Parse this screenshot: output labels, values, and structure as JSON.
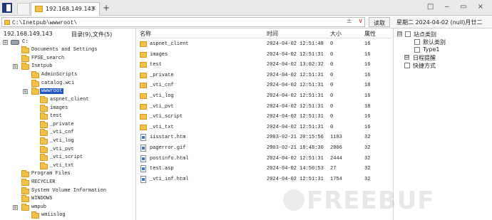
{
  "tabbar": {
    "active_tab": "192.168.149.143",
    "close_glyph": "×",
    "add_glyph": "+",
    "window_buttons": "□ ‒ ▭ ×"
  },
  "address": {
    "path": "C:\\Inetpub\\wwwroot\\",
    "read_label": "读取",
    "date_text": "星期二  2024-04-02 (null)月廿二",
    "ctrl_add": "±",
    "ctrl_chevron": "∨"
  },
  "left": {
    "host": "192.168.149.143",
    "counts": "目录(9),文件(5)",
    "tree": [
      {
        "label": "C:",
        "exp": "⊟"
      },
      {
        "label": "Documents and Settings",
        "exp": ""
      },
      {
        "label": "FPSE_search",
        "exp": ""
      },
      {
        "label": "Inetpub",
        "exp": "⊟"
      },
      {
        "label": "AdminScripts",
        "exp": ""
      },
      {
        "label": "catalog.wci",
        "exp": ""
      },
      {
        "label": "wwwroot",
        "exp": "⊟"
      },
      {
        "label": "aspnet_client",
        "exp": ""
      },
      {
        "label": "images",
        "exp": ""
      },
      {
        "label": "test",
        "exp": ""
      },
      {
        "label": "_private",
        "exp": ""
      },
      {
        "label": "_vti_cnf",
        "exp": ""
      },
      {
        "label": "_vti_log",
        "exp": ""
      },
      {
        "label": "_vti_pvt",
        "exp": ""
      },
      {
        "label": "_vti_script",
        "exp": ""
      },
      {
        "label": "_vti_txt",
        "exp": ""
      },
      {
        "label": "Program Files",
        "exp": ""
      },
      {
        "label": "RECYCLER",
        "exp": ""
      },
      {
        "label": "System Volume Information",
        "exp": ""
      },
      {
        "label": "WINDOWS",
        "exp": ""
      },
      {
        "label": "wmpub",
        "exp": "⊟"
      },
      {
        "label": "wmiislog",
        "exp": ""
      }
    ]
  },
  "list": {
    "headers": {
      "name": "名称",
      "time": "时间",
      "size": "大小",
      "attr": "属性"
    },
    "rows": [
      {
        "name": "aspnet_client",
        "time": "2024-04-02 12:51:48",
        "size": "0",
        "attr": "16",
        "type": "folder"
      },
      {
        "name": "images",
        "time": "2024-04-02 12:51:31",
        "size": "0",
        "attr": "16",
        "type": "folder"
      },
      {
        "name": "test",
        "time": "2024-04-02 13:02:32",
        "size": "0",
        "attr": "16",
        "type": "folder"
      },
      {
        "name": "_private",
        "time": "2024-04-02 12:51:31",
        "size": "0",
        "attr": "16",
        "type": "folder"
      },
      {
        "name": "_vti_cnf",
        "time": "2024-04-02 12:51:31",
        "size": "0",
        "attr": "18",
        "type": "folder"
      },
      {
        "name": "_vti_log",
        "time": "2024-04-02 12:51:31",
        "size": "0",
        "attr": "16",
        "type": "folder"
      },
      {
        "name": "_vti_pvt",
        "time": "2024-04-02 12:51:31",
        "size": "0",
        "attr": "18",
        "type": "folder"
      },
      {
        "name": "_vti_script",
        "time": "2024-04-02 12:51:31",
        "size": "0",
        "attr": "16",
        "type": "folder"
      },
      {
        "name": "_vti_txt",
        "time": "2024-04-02 12:51:31",
        "size": "0",
        "attr": "16",
        "type": "folder"
      },
      {
        "name": "iisstart.htm",
        "time": "2003-02-21 20:15:56",
        "size": "1193",
        "attr": "32",
        "type": "file"
      },
      {
        "name": "pagerror.gif",
        "time": "2003-02-21 18:48:30",
        "size": "2806",
        "attr": "32",
        "type": "file"
      },
      {
        "name": "postinfo.html",
        "time": "2024-04-02 12:51:31",
        "size": "2444",
        "attr": "32",
        "type": "file"
      },
      {
        "name": "test.asp",
        "time": "2024-04-02 14:50:53",
        "size": "27",
        "attr": "32",
        "type": "file"
      },
      {
        "name": "_vti_inf.html",
        "time": "2024-04-02 12:51:31",
        "size": "1754",
        "attr": "32",
        "type": "file"
      }
    ]
  },
  "right": {
    "items": [
      {
        "label": "站点类别",
        "exp": "⊟"
      },
      {
        "label": "默认类别",
        "exp": ""
      },
      {
        "label": "Type1",
        "exp": ""
      },
      {
        "label": "日程提醒",
        "exp": "⊟"
      },
      {
        "label": "快捷方式",
        "exp": ""
      }
    ]
  },
  "watermark": "FREEBUF"
}
